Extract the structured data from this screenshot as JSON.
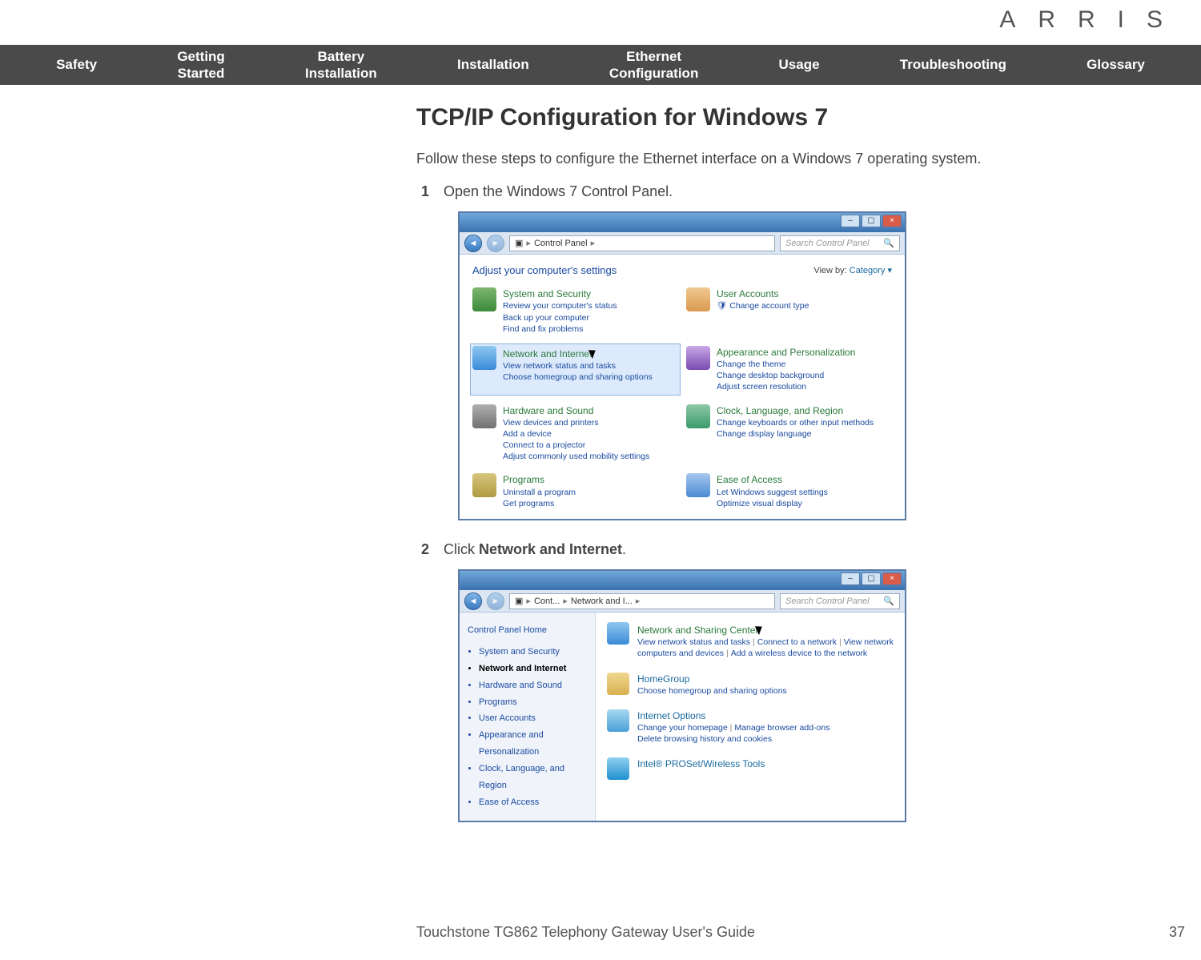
{
  "brand": "ARRIS",
  "nav": {
    "safety": "Safety",
    "getting1": "Getting",
    "getting2": "Started",
    "battery1": "Battery",
    "battery2": "Installation",
    "installation": "Installation",
    "ethernet1": "Ethernet",
    "ethernet2": "Configuration",
    "usage": "Usage",
    "troubleshooting": "Troubleshooting",
    "glossary": "Glossary"
  },
  "title": "TCP/IP Configuration for Windows 7",
  "intro": "Follow these steps to configure the Ethernet interface on a Windows 7 operating system.",
  "steps": {
    "s1num": "1",
    "s1txt": "Open the Windows 7 Control Panel.",
    "s2num": "2",
    "s2pre": "Click ",
    "s2bold": "Network and Internet",
    "s2post": "."
  },
  "shot1": {
    "crumb_main": "Control Panel",
    "search_placeholder": "Search Control Panel",
    "adjust": "Adjust your computer's settings",
    "viewby_label": "View by:",
    "viewby_value": "Category ▾",
    "left": [
      {
        "hd": "System and Security",
        "subs": [
          "Review your computer's status",
          "Back up your computer",
          "Find and fix problems"
        ],
        "ic": "ic-sys"
      },
      {
        "hd": "Network and Internet",
        "subs": [
          "View network status and tasks",
          "Choose homegroup and sharing options"
        ],
        "ic": "ic-net",
        "sel": true,
        "cursor": true
      },
      {
        "hd": "Hardware and Sound",
        "subs": [
          "View devices and printers",
          "Add a device",
          "Connect to a projector",
          "Adjust commonly used mobility settings"
        ],
        "ic": "ic-hw"
      },
      {
        "hd": "Programs",
        "subs": [
          "Uninstall a program",
          "Get programs"
        ],
        "ic": "ic-prog"
      }
    ],
    "right": [
      {
        "hd": "User Accounts",
        "subs": [
          "Change account type"
        ],
        "ic": "ic-user",
        "subicon": true
      },
      {
        "hd": "Appearance and Personalization",
        "subs": [
          "Change the theme",
          "Change desktop background",
          "Adjust screen resolution"
        ],
        "ic": "ic-app"
      },
      {
        "hd": "Clock, Language, and Region",
        "subs": [
          "Change keyboards or other input methods",
          "Change display language"
        ],
        "ic": "ic-clk"
      },
      {
        "hd": "Ease of Access",
        "subs": [
          "Let Windows suggest settings",
          "Optimize visual display"
        ],
        "ic": "ic-ease"
      }
    ]
  },
  "shot2": {
    "crumb1": "Cont...",
    "crumb2": "Network and I...",
    "search_placeholder": "Search Control Panel",
    "side_home": "Control Panel Home",
    "side_items": [
      "System and Security",
      "Network and Internet",
      "Hardware and Sound",
      "Programs",
      "User Accounts",
      "Appearance and Personalization",
      "Clock, Language, and Region",
      "Ease of Access"
    ],
    "side_active_index": 1,
    "items": [
      {
        "hd": "Network and Sharing Center",
        "subs": [
          "View network status and tasks",
          "Connect to a network",
          "View network computers and devices",
          "Add a wireless device to the network"
        ],
        "ic": "ic-net",
        "cursor": true
      },
      {
        "hd": "HomeGroup",
        "subs": [
          "Choose homegroup and sharing options"
        ],
        "ic": "ic-home",
        "linkhd": true
      },
      {
        "hd": "Internet Options",
        "subs": [
          "Change your homepage",
          "Manage browser add-ons",
          "Delete browsing history and cookies"
        ],
        "ic": "ic-ie",
        "linkhd": true,
        "row2break": 2
      },
      {
        "hd": "Intel® PROSet/Wireless Tools",
        "subs": [],
        "ic": "ic-wifi",
        "linkhd": true
      }
    ]
  },
  "footer": {
    "title": "Touchstone TG862 Telephony Gateway User's Guide",
    "page": "37"
  }
}
